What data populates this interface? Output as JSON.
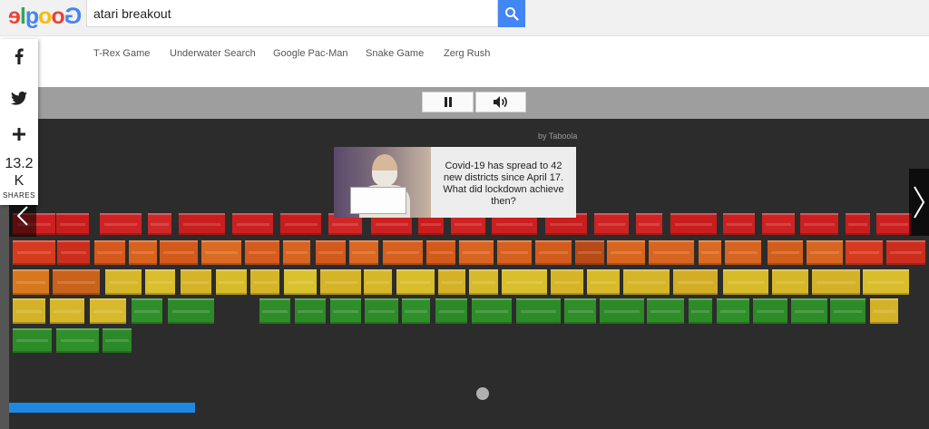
{
  "logo": {
    "letters": [
      "G",
      "o",
      "o",
      "g",
      "l",
      "e"
    ],
    "colors": [
      "#4285f4",
      "#ea4335",
      "#fbbc05",
      "#4285f4",
      "#34a853",
      "#ea4335"
    ]
  },
  "search": {
    "value": "atari breakout",
    "placeholder": "",
    "button_icon": "search-icon"
  },
  "nav": {
    "items": [
      "T-Rex Game",
      "Underwater Search",
      "Google Pac-Man",
      "Snake Game",
      "Zerg Rush"
    ]
  },
  "share": {
    "icons": [
      "facebook-icon",
      "twitter-icon",
      "plus-icon"
    ],
    "count_line1": "13.2",
    "count_line2": "K",
    "label": "SHARES"
  },
  "toolbar": {
    "pause_icon": "pause-icon",
    "sound_icon": "speaker-icon"
  },
  "ad": {
    "by": "by Taboola",
    "headline": "Covid-19 has spread to 42 new districts since April 17. What did lockdown achieve then?"
  },
  "game": {
    "brick_color_rows": [
      [
        "#cc1f1f",
        "#c91d1d",
        "#cf2323",
        "#d02727",
        "#c81e1e",
        "#cc2020",
        "#c91c1c",
        "#d12626",
        "#cd2121",
        "#c81d1d",
        "#cf2222",
        "#cc1f1f",
        "#c81e1e",
        "#cd2323",
        "#d02424",
        "#c91d1d",
        "#cc2020",
        "#cf2222",
        "#cc1f1f",
        "#c91d1d"
      ],
      [
        "#d63b1f",
        "#cc2d1d",
        "#d6581c",
        "#d9621f",
        "#d45a1b",
        "#db6a22",
        "#d55c1e",
        "#d86420",
        "#d35a1c",
        "#da6722",
        "#d7601f",
        "#d45a1b",
        "#d96521",
        "#d6601e",
        "#d35c1c",
        "#b84a15",
        "#d9661f",
        "#d7641f",
        "#da6a22",
        "#d76420",
        "#d35e1c",
        "#d86621"
      ],
      [
        "#d8781e",
        "#c9621b",
        "#d7b72a",
        "#d9be2d",
        "#d6b428",
        "#d8bb2a",
        "#d5b527",
        "#dac12e",
        "#d5b428",
        "#d6b729",
        "#d8bd2c",
        "#d4b127",
        "#d7ba2b",
        "#d9be2d",
        "#d5b527",
        "#d8ba2a",
        "#d6b629",
        "#d3ad26",
        "#d8bb2b",
        "#d6b729",
        "#d4b227",
        "#d9bd2c"
      ],
      [
        "#d4b227",
        "#d6b729",
        "#d8b92b",
        "#2f8f2a",
        "#2d8a28",
        "#2f8d29",
        "#2c8a27",
        "#2e8e29",
        "#2d8b28",
        "#2f8f2a",
        "#2c8927",
        "#2e8d29",
        "#2d8a28",
        "#2f8e2a",
        "#2c8927",
        "#2e8c29",
        "#2d8b28",
        "#2f8f2a",
        "#2c8a27",
        "#2e8d29",
        "#2d8b28"
      ],
      [
        "#2d8b28",
        "#2f8f2a",
        "#2c8927"
      ]
    ]
  }
}
